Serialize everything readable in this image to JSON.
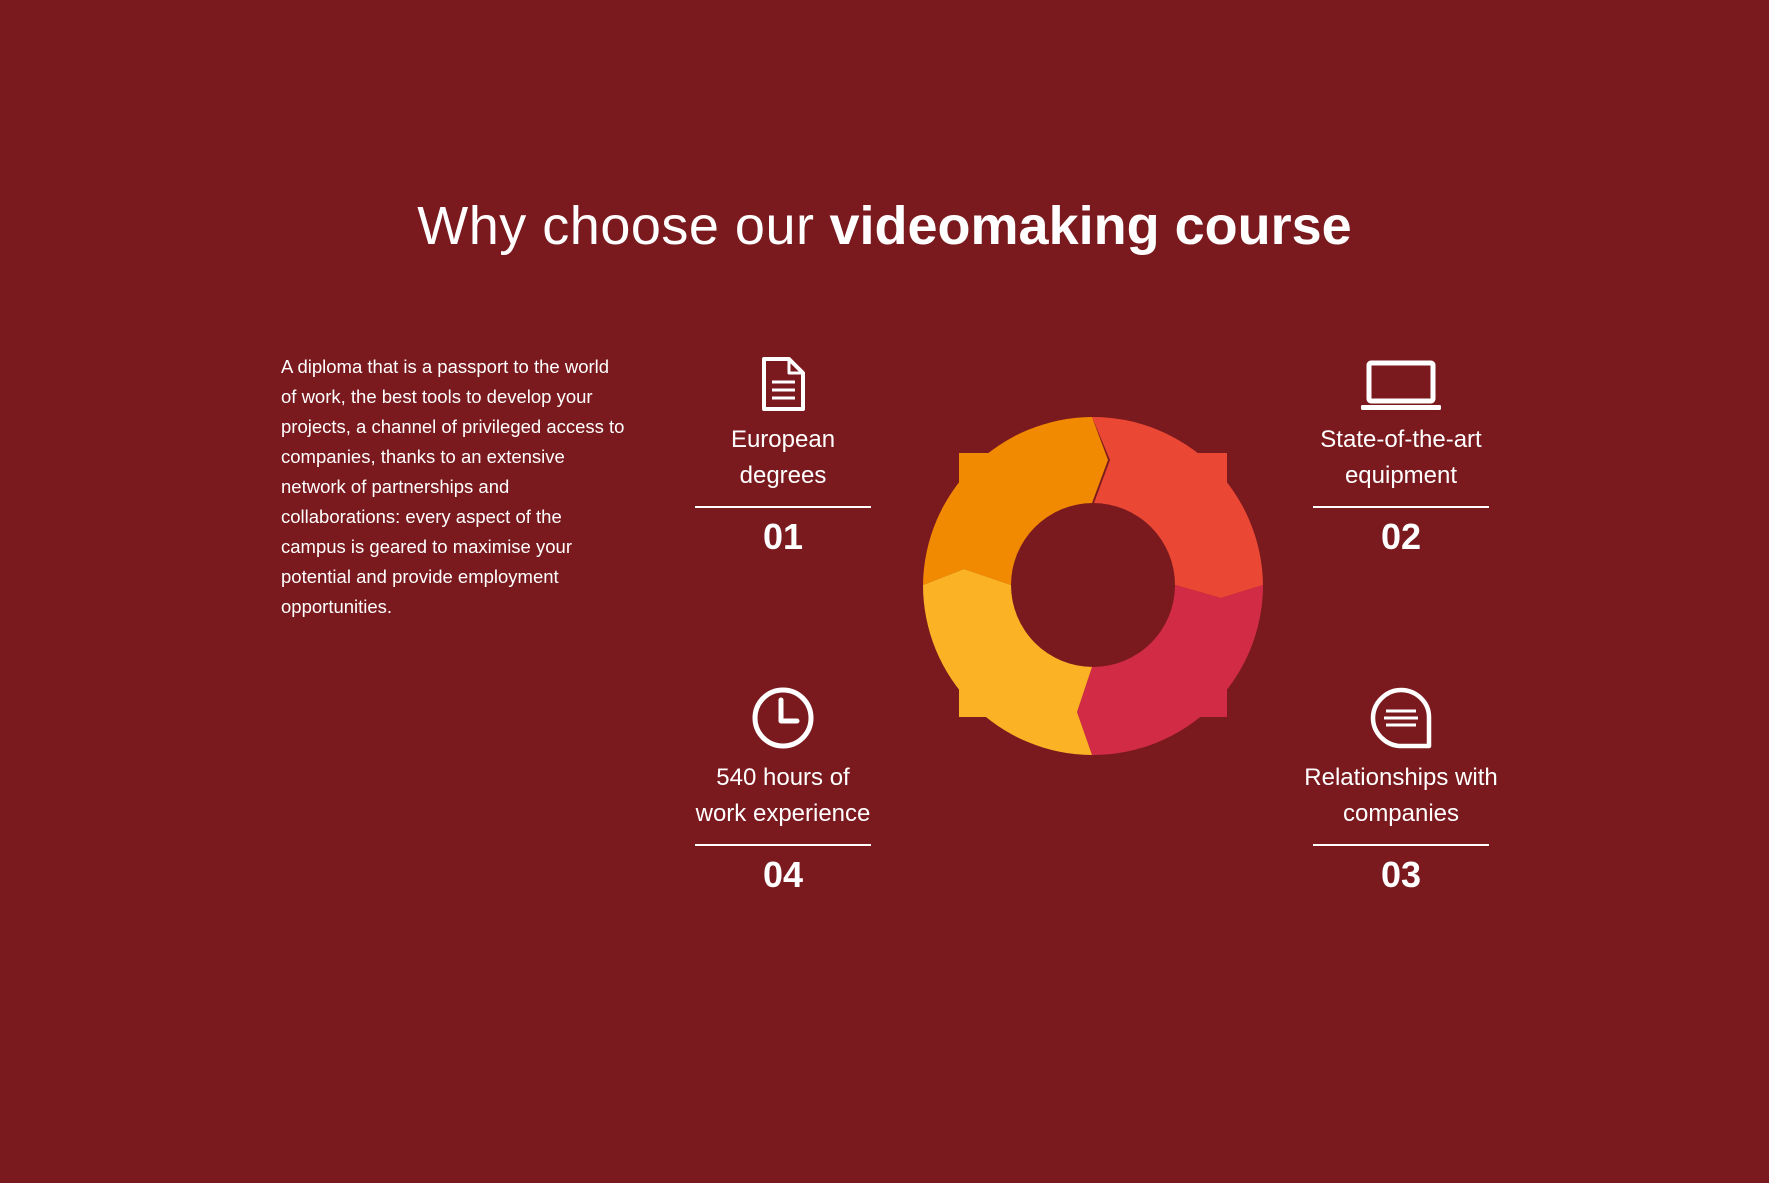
{
  "heading": {
    "light": "Why choose our",
    "bold": "videomaking course"
  },
  "intro": "A diploma that is a passport to the world of work, the best tools to develop your projects, a channel of privileged access to companies, thanks to an extensive network of partnerships and collaborations: every aspect of the campus is geared to maximise your potential and provide employment opportunities.",
  "features": [
    {
      "icon": "document-icon",
      "label_line1": "European",
      "label_line2": "degrees",
      "number": "01"
    },
    {
      "icon": "laptop-icon",
      "label_line1": "State-of-the-art",
      "label_line2": "equipment",
      "number": "02"
    },
    {
      "icon": "chat-bubble-icon",
      "label_line1": "Relationships with",
      "label_line2": "companies",
      "number": "03"
    },
    {
      "icon": "clock-icon",
      "label_line1": "540 hours of",
      "label_line2": "work experience",
      "number": "04"
    }
  ],
  "colors": {
    "background": "#7b1a1e",
    "segment_orange": "#f18a00",
    "segment_red_orange": "#ea4734",
    "segment_crimson": "#d22b46",
    "segment_yellow": "#fbb225"
  }
}
